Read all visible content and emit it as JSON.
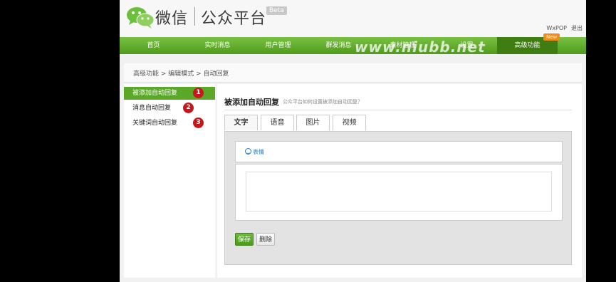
{
  "header": {
    "brand_name": "微信",
    "brand_title": "公众平台",
    "beta": "Beta",
    "user_name": "WxPOP",
    "logout": "退出"
  },
  "nav": {
    "items": [
      {
        "label": "首页"
      },
      {
        "label": "实时消息"
      },
      {
        "label": "用户管理"
      },
      {
        "label": "群发消息"
      },
      {
        "label": "素材管理"
      },
      {
        "label": "设置"
      },
      {
        "label": "高级功能"
      }
    ],
    "new_badge": "New",
    "watermark": "www.niubb.net"
  },
  "breadcrumb": "高级功能 > 编辑模式 > 自动回复",
  "sidebar": {
    "items": [
      {
        "label": "被添加自动回复",
        "num": "1"
      },
      {
        "label": "消息自动回复",
        "num": "2"
      },
      {
        "label": "关键词自动回复",
        "num": "3"
      }
    ]
  },
  "main": {
    "title": "被添加自动回复",
    "help": "公众平台如何设置被添加自动回复？",
    "tabs": [
      {
        "label": "文字"
      },
      {
        "label": "语音"
      },
      {
        "label": "图片"
      },
      {
        "label": "视频"
      }
    ],
    "emoji_label": "表情",
    "save_label": "保存",
    "delete_label": "删除"
  },
  "colors": {
    "nav_green": "#5ba829",
    "badge_red": "#c8161d",
    "new_orange": "#f08c1a"
  }
}
